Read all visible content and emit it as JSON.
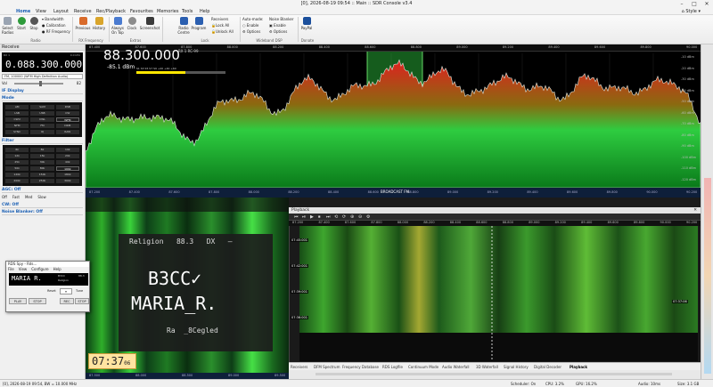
{
  "window": {
    "title": "[0], 2026-08-19 09:54 :: Main :: SDR Console v3.4",
    "style_label": "Style"
  },
  "menu": [
    "Home",
    "View",
    "Layout",
    "Receive",
    "Rec/Playback",
    "Favourites",
    "Memories",
    "Tools",
    "Help"
  ],
  "ribbon": {
    "select_radios": "Select Radios",
    "start": "Start",
    "stop": "Stop",
    "bandwidth": "Bandwidth",
    "calibration": "Calibration",
    "rf_frequency": "RF Frequency",
    "previous": "Previous",
    "history": "History",
    "always": "Always",
    "on_top": "On Top",
    "clock": "Clock",
    "screenshot": "Screenshot",
    "radio_centre": "Radio Centre",
    "program": "Program",
    "receivers": "Receivers",
    "lock_all": "Lock All",
    "unlock_all": "Unlock All",
    "auto_mode": "Auto-mode:",
    "enable": "Enable",
    "options": "Options",
    "noise_blanker": "Noise Blanker",
    "enable2": "Enable",
    "options2": "Options",
    "paypal": "PayPal",
    "groups": [
      "Radio",
      "RX Frequency",
      "Extras",
      "Lock",
      "Wideband DSP",
      "Donate"
    ]
  },
  "left": {
    "header": "Receive",
    "vfo_label": "RX 1",
    "khz_label": "0.0 kHz",
    "frequency": "0.088.300.000",
    "preset": "FM, 100000 (WFM High Definition Audio)",
    "volume_label": "Vol",
    "volume_value": "82",
    "sections": {
      "display": "IF Display",
      "mode": "Mode",
      "filter": "Filter",
      "agc": "AGC: Off",
      "cw": "CW: Off",
      "noise_blanker": "Noise Blanker: Off",
      "agc_options": [
        "Off",
        "Fast",
        "Med",
        "Slow"
      ]
    },
    "mode_buttons": [
      "AM",
      "SAM",
      "DSB",
      "LSB",
      "USB",
      "CW",
      "CWU",
      "CWL",
      "WFM",
      "NFM",
      "FM",
      "DRM",
      "SYNC",
      "IQ",
      "RAW"
    ],
    "mode_active": "WFM",
    "filter_buttons": [
      "6k",
      "8k",
      "10k",
      "12k",
      "15k",
      "20k",
      "25k",
      "30k",
      "40k",
      "50k",
      "80k",
      "100k",
      "120k",
      "150k",
      "180k",
      "200k",
      "250k",
      "300k"
    ],
    "filter_active": "100k"
  },
  "spectrum": {
    "display_frequency": "88.300.000",
    "rx_info": "RX 1    RC-99",
    "signal_dbm": "-85.1 dBm",
    "meter_scale": "S1  S3  S5  S7  S9  +20  +40  +60",
    "top_ticks": [
      "87.400",
      "87.600",
      "87.800",
      "88.000",
      "88.200",
      "88.400",
      "88.600",
      "88.800",
      "89.000",
      "89.200",
      "89.400",
      "89.600",
      "89.800",
      "90.000"
    ],
    "y_ticks": [
      "-10 dBm",
      "-20 dBm",
      "-30 dBm",
      "-40 dBm",
      "-50 dBm",
      "-60 dBm",
      "-70 dBm",
      "-80 dBm",
      "-90 dBm",
      "-100 dBm",
      "-110 dBm",
      "-120 dBm"
    ],
    "bottom_ticks": [
      "87.200",
      "87.400",
      "87.600",
      "87.800",
      "88.000",
      "88.200",
      "88.400",
      "88.600",
      "88.800",
      "89.000",
      "89.200",
      "89.400",
      "89.600",
      "89.800",
      "90.000",
      "90.200"
    ],
    "band_label": "BROADCAST FM",
    "channel_center": 88.3,
    "channel_width_mhz": 0.2
  },
  "rds": {
    "line1": "Religion   88.3   DX   —",
    "ps1": "B3CC✓",
    "ps2": "MARIA_R.",
    "rt": "Ra  _8Cegled",
    "clock": "07:37",
    "clock_sec": "06",
    "waterfall_ticks": [
      "87.500",
      "88.000",
      "88.500",
      "89.000",
      "89.500"
    ]
  },
  "rds_spy": {
    "title": "RDS Spy - Rds...",
    "menu": [
      "File",
      "View",
      "Configure",
      "Help"
    ],
    "ps": "MARIA R.",
    "pi": "B3CC",
    "pty": "Religion",
    "freq": "88.3",
    "reset_label": "Reset",
    "tune_label": "Tune",
    "buttons": [
      "PLAY",
      "STOP",
      "REC",
      "STOP"
    ]
  },
  "playback": {
    "title": "Playback",
    "axis_ticks": [
      "87.200",
      "87.400",
      "87.600",
      "87.800",
      "88.000",
      "88.200",
      "88.400",
      "88.600",
      "88.800",
      "89.000",
      "89.200",
      "89.400",
      "89.600",
      "89.800",
      "90.000",
      "90.200"
    ],
    "time_markers": [
      "07:45:001",
      "07:42:001",
      "07:39:001",
      "07:36:001"
    ],
    "position_label": "07:37:06",
    "tabs": [
      "Receivers",
      "DFM Spectrum",
      "Frequency Database",
      "RDS Logfile",
      "Continuum Mode",
      "Audio Waterfall",
      "3D Waterfall",
      "Signal History",
      "Digital Decoder",
      "Playback"
    ],
    "active_tab": "Playback"
  },
  "status": {
    "left": "[0], 2026-08-19 09:54, BW = 10.000 MHz",
    "scheduler": "Scheduler: On",
    "cpu": "CPU: 3.2%",
    "gpu": "GPU: 16.2%",
    "audio": "Audio: 10ms",
    "size": "Size: 3.1 GB"
  },
  "colors": {
    "accent": "#1a5fb4",
    "signal_green": "#2ecc40",
    "signal_red": "#e02020",
    "axis_blue": "#0e1f3a"
  }
}
